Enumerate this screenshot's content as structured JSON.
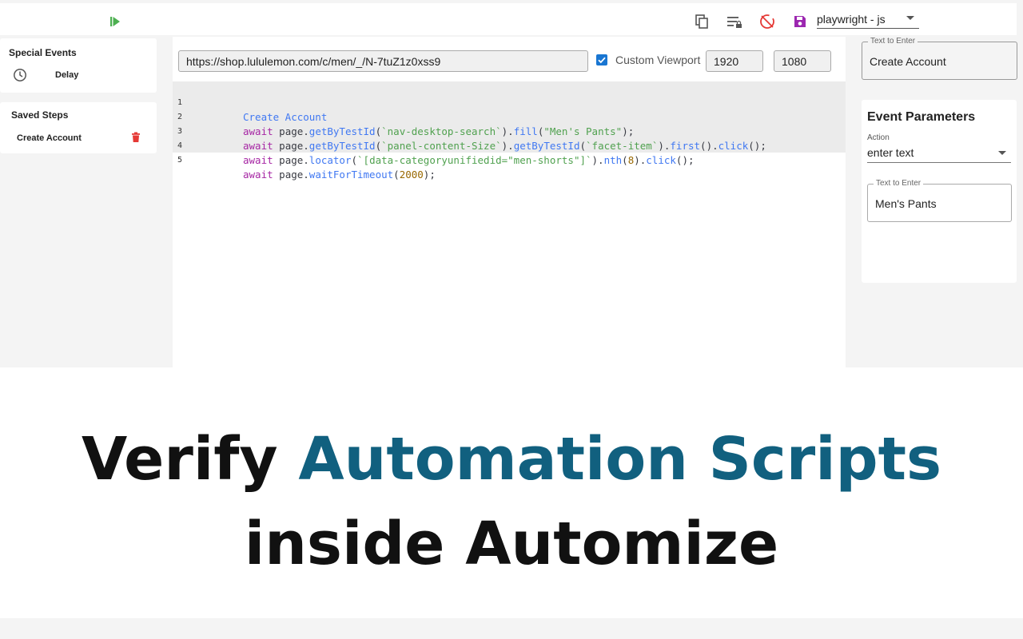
{
  "toolbar": {
    "language_select": "playwright - js",
    "icons": [
      "play-icon",
      "copy-icon",
      "lock-list-icon",
      "disable-sync-icon",
      "save-icon"
    ],
    "colors": {
      "play": "#4caf50",
      "save": "#9c27b0",
      "disable": "#e53935"
    }
  },
  "sidebar": {
    "special_events": {
      "title": "Special Events",
      "items": [
        {
          "label": "Delay",
          "icon": "clock-icon"
        }
      ]
    },
    "saved_steps": {
      "title": "Saved Steps",
      "items": [
        {
          "label": "Create Account",
          "icon": "trash-icon"
        }
      ]
    }
  },
  "editor": {
    "url": "https://shop.lululemon.com/c/men/_/N-7tuZ1z0xss9",
    "custom_viewport_label": "Custom Viewport",
    "custom_viewport_checked": true,
    "viewport_width": "1920",
    "viewport_height": "1080",
    "lines": [
      {
        "num": "1",
        "text": "Create Account"
      },
      {
        "num": "2",
        "text": "await page.getByTestId(`nav-desktop-search`).fill(\"Men's Pants\");"
      },
      {
        "num": "3",
        "text": "await page.getByTestId(`panel-content-Size`).getByTestId(`facet-item`).first().click();"
      },
      {
        "num": "4",
        "text": "await page.locator(`[data-categoryunifiedid=\"men-shorts\"]`).nth(8).click();"
      },
      {
        "num": "5",
        "text": "await page.waitForTimeout(2000);"
      }
    ]
  },
  "right_panel": {
    "top_field": {
      "legend": "Text to Enter",
      "value": "Create Account"
    },
    "event_parameters": {
      "title": "Event Parameters",
      "action_label": "Action",
      "action_value": "enter text",
      "text_field": {
        "legend": "Text to Enter",
        "value": "Men's Pants"
      }
    }
  },
  "banner": {
    "line1_plain": "Verify",
    "line1_accent": "Automation Scripts",
    "line2": "inside Automize",
    "accent_color": "#11607f"
  }
}
